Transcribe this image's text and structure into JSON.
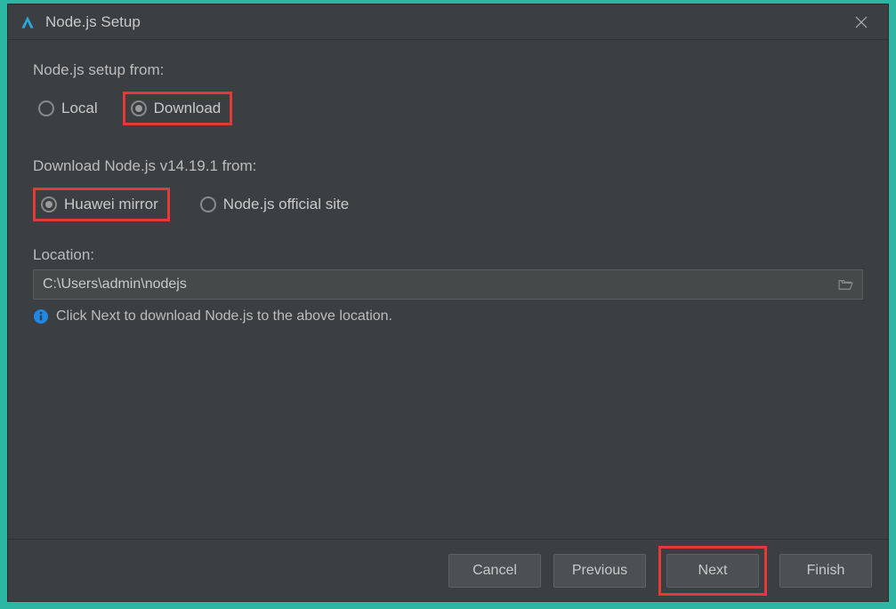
{
  "titlebar": {
    "title": "Node.js Setup"
  },
  "setupFrom": {
    "label": "Node.js setup from:",
    "options": {
      "local": "Local",
      "download": "Download"
    }
  },
  "downloadFrom": {
    "label": "Download Node.js v14.19.1 from:",
    "options": {
      "huawei": "Huawei mirror",
      "official": "Node.js official site"
    }
  },
  "location": {
    "label": "Location:",
    "value": "C:\\Users\\admin\\nodejs"
  },
  "info": {
    "text": "Click Next to download Node.js to the above location."
  },
  "buttons": {
    "cancel": "Cancel",
    "previous": "Previous",
    "next": "Next",
    "finish": "Finish"
  },
  "colors": {
    "highlight": "#e53935",
    "background": "#3c3f41",
    "text": "#bcbcbc",
    "info_icon": "#1e88e5"
  }
}
